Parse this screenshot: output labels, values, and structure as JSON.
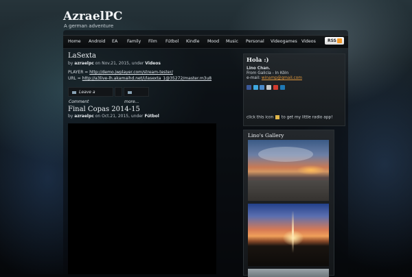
{
  "site": {
    "title": "AzraelPC",
    "tagline": "A german adventure"
  },
  "nav": {
    "items": [
      "Home",
      "Android",
      "EA",
      "Family",
      "Film",
      "Fútbol",
      "Kindle",
      "Mood",
      "Music",
      "Personal",
      "Videogames",
      "Videos"
    ],
    "rss_label": "RSS"
  },
  "posts": [
    {
      "title": "LaSexta",
      "meta_prefix": "by",
      "author": "azraelpc",
      "meta_on": "on Nov.21, 2015, under",
      "category": "Videos",
      "lines": [
        {
          "label": "PLAYER =",
          "link": "http://demo.jwplayer.com/stream-tester/"
        },
        {
          "label": "URL =",
          "link": "http://a3live-lh.akamaihd.net/i/lasexta_1@35272/master.m3u8"
        }
      ],
      "buttons": {
        "comment": "Leave a Comment",
        "more": "more..."
      }
    },
    {
      "title": "Final Copas 2014-15",
      "meta_prefix": "by",
      "author": "azraelpc",
      "meta_on": "on Oct.21, 2015, under",
      "category": "Fútbol"
    }
  ],
  "sidebar": {
    "hola_title": "Hola :)",
    "name": "Lino Chan.",
    "from": "From Galicia - In Köln",
    "email_label": "e-mail:",
    "email": "winamp@gmail.com",
    "radio_text_before": "click this icon",
    "radio_text_after": "to get my little radio app!",
    "social_icons": [
      {
        "name": "facebook-icon",
        "color": "#3b5998"
      },
      {
        "name": "twitter-icon",
        "color": "#3fa9e0"
      },
      {
        "name": "tuenti-icon",
        "color": "#4a88c8"
      },
      {
        "name": "mail-icon",
        "color": "#c7c7c7"
      },
      {
        "name": "youtube-icon",
        "color": "#d23b2f"
      },
      {
        "name": "linkedin-icon",
        "color": "#1f78b4"
      }
    ],
    "gallery_title": "Lino's Gallery"
  },
  "colors": {
    "link_orange": "#e59a3c",
    "background": "#06080b"
  }
}
